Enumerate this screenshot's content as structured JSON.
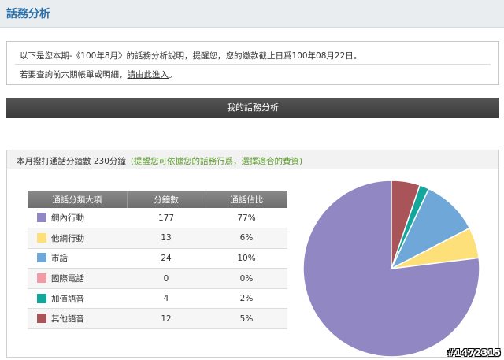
{
  "header": {
    "title": "話務分析"
  },
  "notice": {
    "line1": "以下是您本期-《100年8月》的話務分析說明，提醒您，您的繳款截止日爲100年08月22日。",
    "line2_prefix": "若要查詢前六期帳單或明細，",
    "line2_link": "請由此進入",
    "line2_suffix": "。"
  },
  "section_bar": {
    "title": "我的話務分析"
  },
  "usage": {
    "summary": "本月撥打通話分鐘數 230分鐘",
    "hint": "(提醒您可依據您的話務行爲，選擇適合的費資)",
    "columns": [
      "通話分類大項",
      "分鐘數",
      "通話佔比"
    ]
  },
  "chart_data": {
    "type": "pie",
    "categories": [
      "網內行動",
      "他網行動",
      "市話",
      "國際電話",
      "加值語音",
      "其他語音"
    ],
    "values": [
      177,
      13,
      24,
      0,
      4,
      12
    ],
    "percent_labels": [
      "77%",
      "6%",
      "10%",
      "0%",
      "2%",
      "5%"
    ],
    "colors": [
      "#9187c2",
      "#fde07a",
      "#6fa7d8",
      "#f29aa6",
      "#13a69a",
      "#a85458"
    ]
  },
  "watermark": "#1472315"
}
